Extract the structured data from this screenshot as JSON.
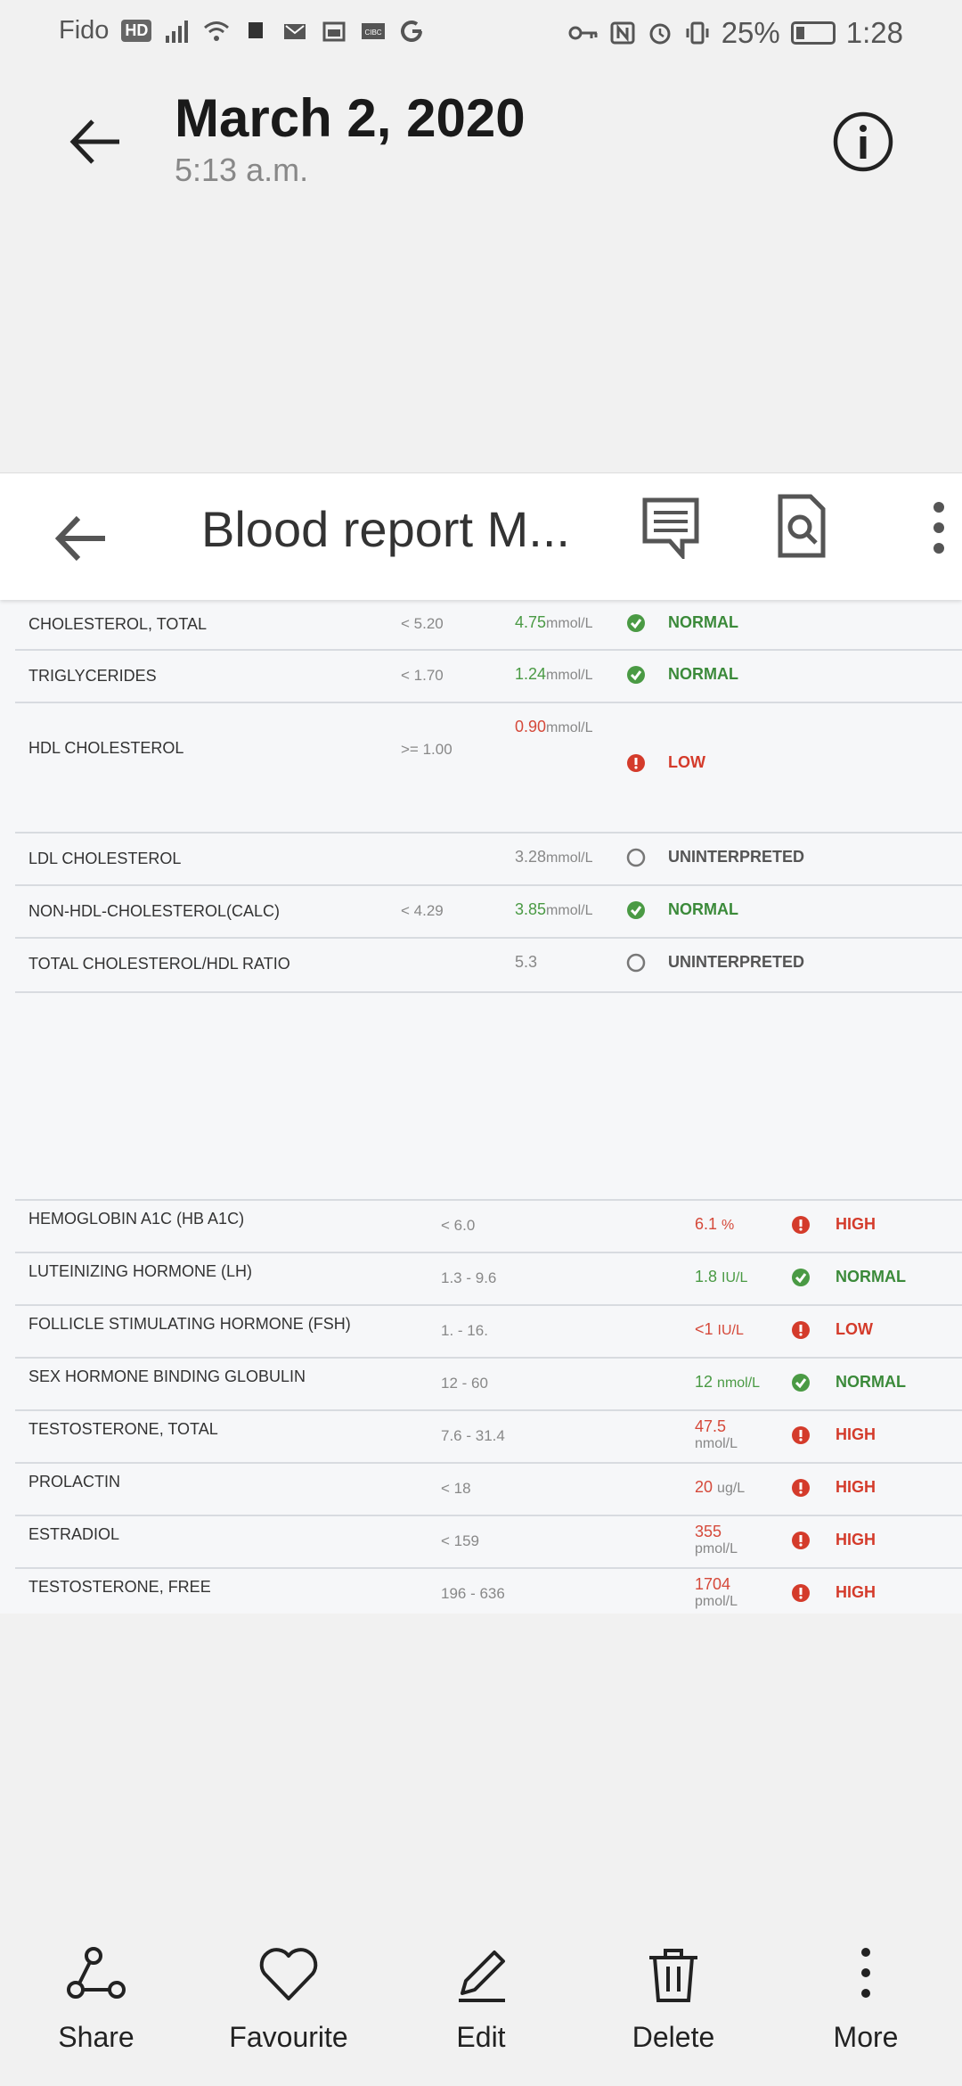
{
  "status_bar": {
    "carrier": "Fido",
    "hd_badge": "HD",
    "battery_percent": "25%",
    "time": "1:28"
  },
  "header": {
    "date": "March 2, 2020",
    "time": "5:13 a.m."
  },
  "document": {
    "title": "Blood report M...",
    "lipid_rows": [
      {
        "name": "CHOLESTEROL, TOTAL",
        "ref": "< 5.20",
        "value": "4.75",
        "unit": "mmol/L",
        "status": "NORMAL",
        "tone": "normal"
      },
      {
        "name": "TRIGLYCERIDES",
        "ref": "< 1.70",
        "value": "1.24",
        "unit": "mmol/L",
        "status": "NORMAL",
        "tone": "normal"
      },
      {
        "name": "HDL CHOLESTEROL",
        "ref": ">= 1.00",
        "value": "0.90",
        "unit": "mmol/L",
        "status": "LOW",
        "tone": "abnormal"
      },
      {
        "name": "LDL CHOLESTEROL",
        "ref": "",
        "value": "3.28",
        "unit": "mmol/L",
        "status": "UNINTERPRETED",
        "tone": "none"
      },
      {
        "name": "NON-HDL-CHOLESTEROL(CALC)",
        "ref": "< 4.29",
        "value": "3.85",
        "unit": "mmol/L",
        "status": "NORMAL",
        "tone": "normal"
      },
      {
        "name": "TOTAL CHOLESTEROL/HDL RATIO",
        "ref": "",
        "value": "5.3",
        "unit": "",
        "status": "UNINTERPRETED",
        "tone": "none"
      }
    ],
    "hormone_rows": [
      {
        "name": "HEMOGLOBIN A1C (HB A1C)",
        "ref": "< 6.0",
        "value": "6.1",
        "unit": "%",
        "status": "HIGH",
        "tone": "abnormal"
      },
      {
        "name": "LUTEINIZING HORMONE (LH)",
        "ref": "1.3 - 9.6",
        "value": "1.8",
        "unit": "IU/L",
        "status": "NORMAL",
        "tone": "normal"
      },
      {
        "name": "FOLLICLE STIMULATING HORMONE (FSH)",
        "ref": "1. - 16.",
        "value": "<1",
        "unit": "IU/L",
        "status": "LOW",
        "tone": "abnormal"
      },
      {
        "name": "SEX HORMONE BINDING GLOBULIN",
        "ref": "12 - 60",
        "value": "12",
        "unit": "nmol/L",
        "status": "NORMAL",
        "tone": "normal"
      },
      {
        "name": "TESTOSTERONE, TOTAL",
        "ref": "7.6 - 31.4",
        "value": "47.5",
        "unit": "nmol/L",
        "status": "HIGH",
        "tone": "abnormal"
      },
      {
        "name": "PROLACTIN",
        "ref": "< 18",
        "value": "20",
        "unit": "ug/L",
        "status": "HIGH",
        "tone": "abnormal"
      },
      {
        "name": "ESTRADIOL",
        "ref": "< 159",
        "value": "355",
        "unit": "pmol/L",
        "status": "HIGH",
        "tone": "abnormal"
      },
      {
        "name": "TESTOSTERONE, FREE",
        "ref": "196 - 636",
        "value": "1704",
        "unit": "pmol/L",
        "status": "HIGH",
        "tone": "abnormal"
      }
    ]
  },
  "bottom_bar": {
    "share": "Share",
    "favourite": "Favourite",
    "edit": "Edit",
    "delete": "Delete",
    "more": "More"
  },
  "colors": {
    "normal": "#3b8a3a",
    "abnormal": "#d43b2b",
    "neutral": "#555555"
  }
}
